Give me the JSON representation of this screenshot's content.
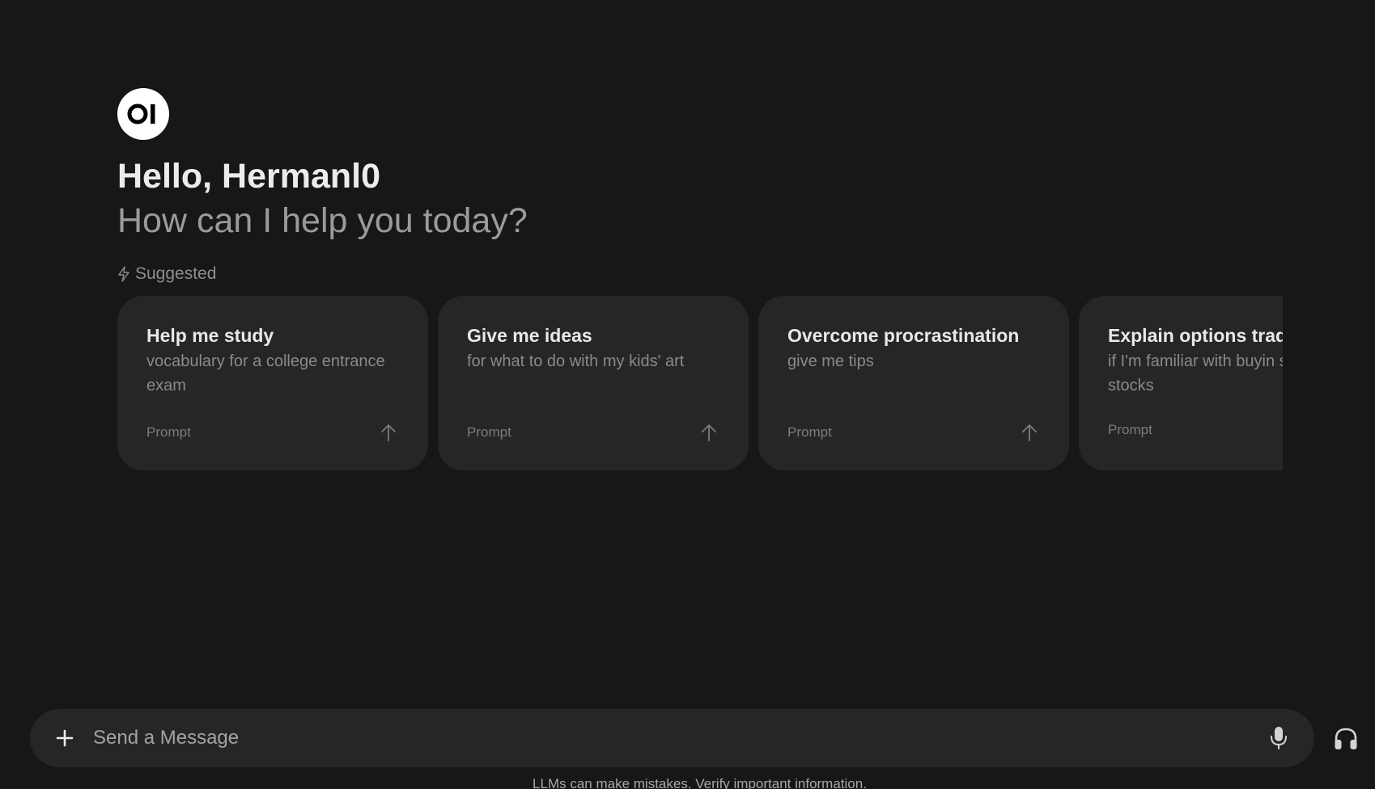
{
  "greeting": {
    "hello": "Hello, Hermanl0",
    "subtitle": "How can I help you today?"
  },
  "suggested": {
    "label": "Suggested",
    "icon": "bolt-icon",
    "cards": [
      {
        "title": "Help me study",
        "description": "vocabulary for a college entrance exam",
        "kind": "Prompt"
      },
      {
        "title": "Give me ideas",
        "description": "for what to do with my kids' art",
        "kind": "Prompt"
      },
      {
        "title": "Overcome procrastination",
        "description": "give me tips",
        "kind": "Prompt"
      },
      {
        "title": "Explain options trad",
        "description": "if I'm familiar with buyin selling stocks",
        "kind": "Prompt"
      }
    ]
  },
  "composer": {
    "placeholder": "Send a Message",
    "plus_icon": "plus-icon",
    "mic_icon": "microphone-icon",
    "headphones_icon": "headphones-icon"
  },
  "footer": {
    "disclaimer": "LLMs can make mistakes. Verify important information."
  },
  "colors": {
    "background": "#171717",
    "card": "#262626",
    "text": "#ececec",
    "muted": "#9b9b9b"
  }
}
